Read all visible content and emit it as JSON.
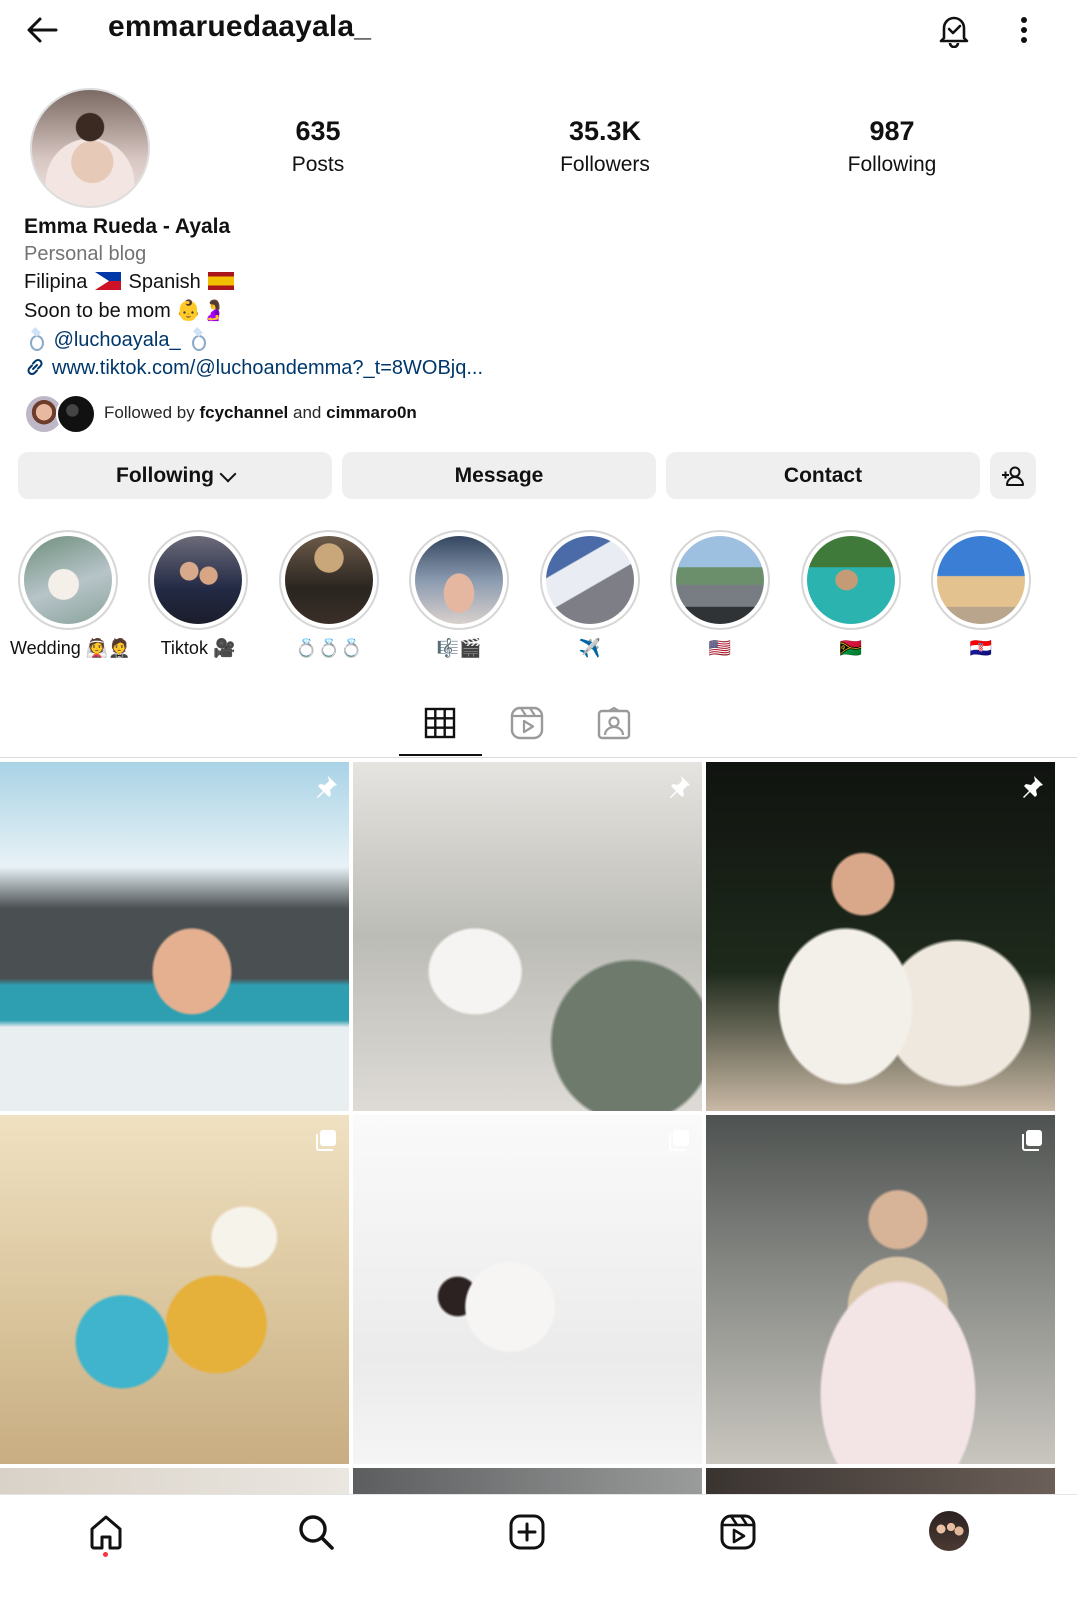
{
  "header": {
    "username": "emmaruedaayala_"
  },
  "profile": {
    "stats": [
      {
        "value": "635",
        "label": "Posts"
      },
      {
        "value": "35.3K",
        "label": "Followers"
      },
      {
        "value": "987",
        "label": "Following"
      }
    ],
    "full_name": "Emma Rueda - Ayala",
    "category": "Personal blog",
    "bio_line1_a": "Filipina",
    "bio_line1_b": "Spanish",
    "bio_line2": "Soon to be mom 👶🤰",
    "bio_mention": "@luchoayala_",
    "bio_link": "www.tiktok.com/@luchoandemma?_t=8WOBjq..."
  },
  "followed_by": {
    "prefix": "Followed by",
    "user1": "fcychannel",
    "conj": "and",
    "user2": "cimmaro0n"
  },
  "actions": {
    "following": "Following",
    "message": "Message",
    "contact": "Contact"
  },
  "highlights": [
    {
      "label": "Wedding 👰🤵"
    },
    {
      "label": "Tiktok 🎥"
    },
    {
      "label": "💍💍💍"
    },
    {
      "label": "🎼🎬"
    },
    {
      "label": "✈️"
    },
    {
      "label": "🇺🇸"
    },
    {
      "label": "🇻🇺"
    },
    {
      "label": "🇭🇷"
    }
  ],
  "icons": {
    "back": "back-arrow-icon",
    "notifications": "bell-icon",
    "more": "more-options-icon",
    "grid_tab": "grid-icon",
    "reels_tab": "reels-icon",
    "tagged_tab": "tagged-icon",
    "pinned": "pin-icon",
    "carousel": "carousel-icon",
    "nav": [
      "home-icon",
      "search-icon",
      "create-icon",
      "reels-icon",
      "profile-avatar"
    ]
  },
  "colors": {
    "link": "#00376b",
    "muted": "#737373",
    "button_bg": "#efefef",
    "notification_dot": "#ff3040"
  }
}
